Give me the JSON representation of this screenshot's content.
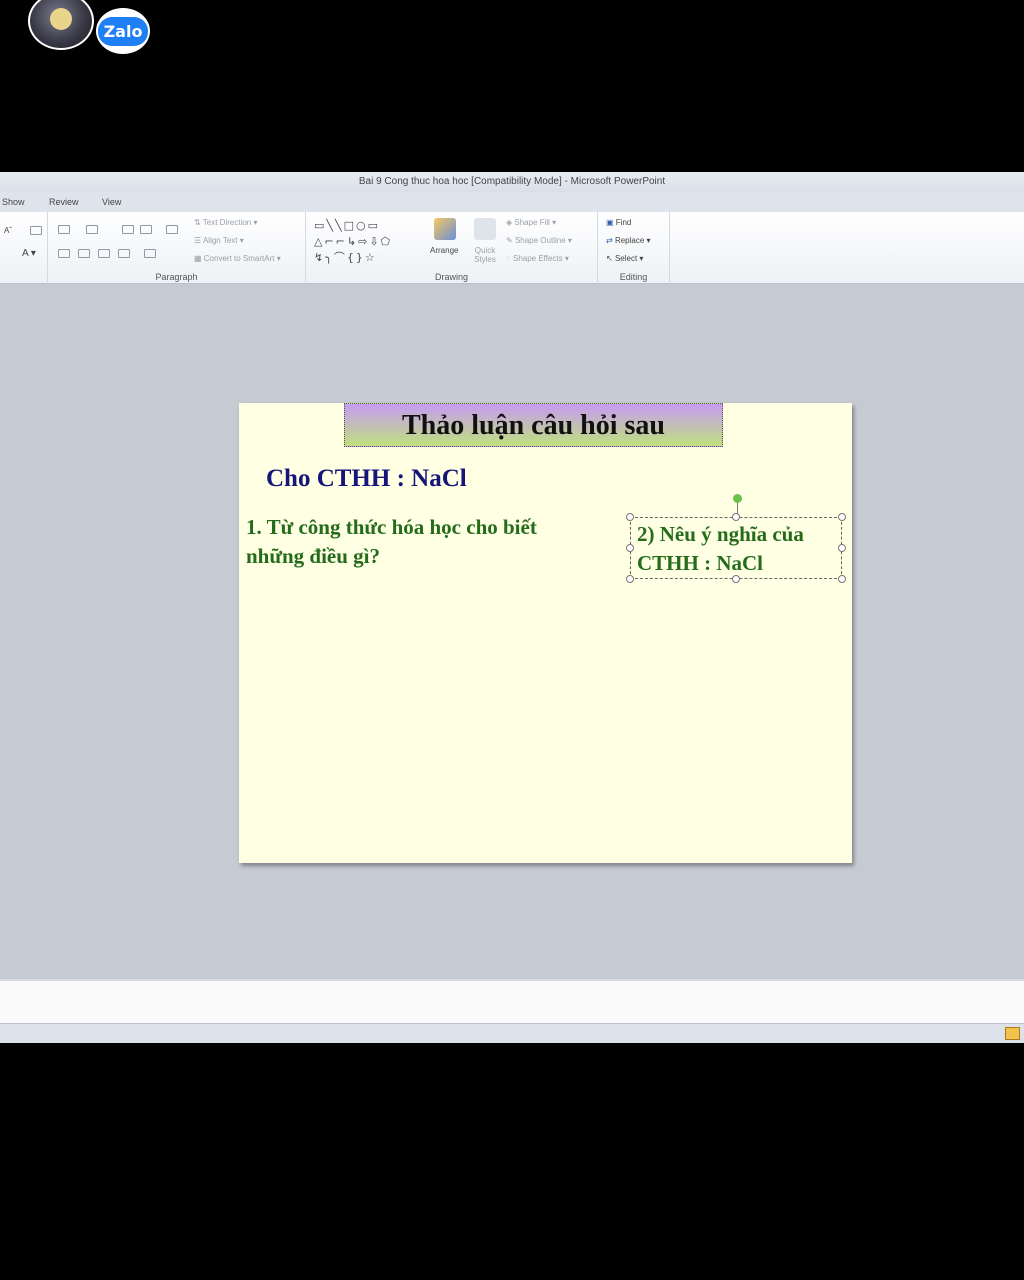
{
  "overlay": {
    "app_badge": "Zalo"
  },
  "window": {
    "title": "Bai 9 Cong thuc hoa hoc [Compatibility Mode] - Microsoft PowerPoint"
  },
  "tabs": [
    "Show",
    "Review",
    "View"
  ],
  "ribbon": {
    "paragraph": {
      "label": "Paragraph",
      "text_direction": "Text Direction",
      "align_text": "Align Text",
      "convert_smartart": "Convert to SmartArt"
    },
    "drawing": {
      "label": "Drawing",
      "arrange": "Arrange",
      "quick_styles": "Quick Styles",
      "shape_fill": "Shape Fill",
      "shape_outline": "Shape Outline",
      "shape_effects": "Shape Effects"
    },
    "editing": {
      "label": "Editing",
      "find": "Find",
      "replace": "Replace",
      "select": "Select"
    }
  },
  "slide": {
    "title": "Thảo luận câu hỏi sau",
    "subtitle": "Cho CTHH :  NaCl",
    "question1": "1. Từ công thức hóa học cho biết những điều gì?",
    "question2": "2) Nêu ý nghĩa của CTHH :  NaCl"
  }
}
